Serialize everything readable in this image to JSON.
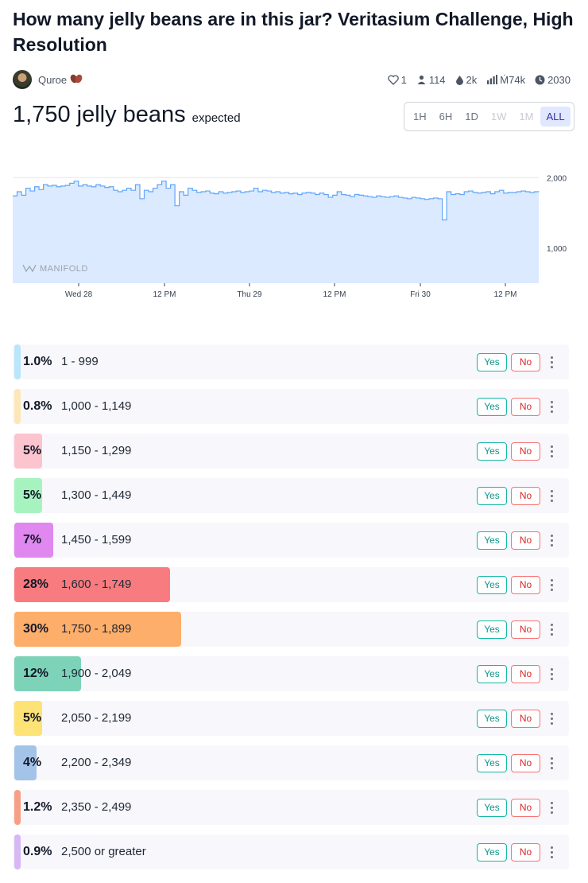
{
  "market": {
    "title": "How many jelly beans are in this jar? Veritasium Challenge, High Resolution",
    "author": "Quroe",
    "author_badge_icon": "beans-icon",
    "stats": {
      "likes": "1",
      "traders": "114",
      "liquidity": "2k",
      "volume": "Ṁ74k",
      "close": "2030"
    },
    "expected_value": "1,750 jelly beans",
    "expected_label": "expected"
  },
  "time_ranges": [
    {
      "label": "1H",
      "state": "normal"
    },
    {
      "label": "6H",
      "state": "normal"
    },
    {
      "label": "1D",
      "state": "normal"
    },
    {
      "label": "1W",
      "state": "disabled"
    },
    {
      "label": "1M",
      "state": "disabled"
    },
    {
      "label": "ALL",
      "state": "active"
    }
  ],
  "chart_data": {
    "type": "area",
    "watermark": "MANIFOLD",
    "x_ticks": [
      "Wed 28",
      "12 PM",
      "Thu 29",
      "12 PM",
      "Fri 30",
      "12 PM"
    ],
    "y_ticks": [
      "2,000",
      "1,000"
    ],
    "ylim": [
      500,
      2150
    ],
    "fill_color": "#dbeafe",
    "line_color": "#60a5fa",
    "series": [
      {
        "values": [
          1740,
          1800,
          1750,
          1850,
          1810,
          1870,
          1830,
          1900,
          1880,
          1890,
          1870,
          1880,
          1890,
          1920,
          1950,
          1880,
          1900,
          1880,
          1870,
          1900,
          1880,
          1860,
          1870,
          1820,
          1800,
          1820,
          1850,
          1820,
          1900,
          1700,
          1820,
          1800,
          1850,
          1900,
          1950,
          1850,
          1900,
          1600,
          1800,
          1750,
          1850,
          1820,
          1790,
          1800,
          1810,
          1780,
          1770,
          1800,
          1780,
          1790,
          1800,
          1810,
          1790,
          1800,
          1810,
          1850,
          1800,
          1820,
          1810,
          1790,
          1800,
          1780,
          1790,
          1770,
          1780,
          1760,
          1780,
          1790,
          1780,
          1760,
          1780,
          1760,
          1720,
          1750,
          1800,
          1760,
          1750,
          1730,
          1760,
          1750,
          1740,
          1730,
          1720,
          1740,
          1730,
          1720,
          1730,
          1740,
          1720,
          1710,
          1700,
          1720,
          1710,
          1700,
          1690,
          1700,
          1710,
          1700,
          1400,
          1800,
          1760,
          1770,
          1760,
          1800,
          1810,
          1790,
          1780,
          1790,
          1800,
          1770,
          1800,
          1820,
          1780,
          1790,
          1790,
          1800,
          1810,
          1800,
          1790,
          1800,
          1795
        ]
      }
    ]
  },
  "answers": [
    {
      "pct": "1.0%",
      "range": "1 - 999",
      "fraction": 0.01,
      "color": "#bae6fd"
    },
    {
      "pct": "0.8%",
      "range": "1,000 - 1,149",
      "fraction": 0.008,
      "color": "#fde7b8"
    },
    {
      "pct": "5%",
      "range": "1,150 - 1,299",
      "fraction": 0.05,
      "color": "#fbc4cf"
    },
    {
      "pct": "5%",
      "range": "1,300 - 1,449",
      "fraction": 0.05,
      "color": "#a7f3c0"
    },
    {
      "pct": "7%",
      "range": "1,450 - 1,599",
      "fraction": 0.07,
      "color": "#e087f0"
    },
    {
      "pct": "28%",
      "range": "1,600 - 1,749",
      "fraction": 0.28,
      "color": "#f87c7f"
    },
    {
      "pct": "30%",
      "range": "1,750 - 1,899",
      "fraction": 0.3,
      "color": "#fdae6b"
    },
    {
      "pct": "12%",
      "range": "1,900 - 2,049",
      "fraction": 0.12,
      "color": "#7dd3b8"
    },
    {
      "pct": "5%",
      "range": "2,050 - 2,199",
      "fraction": 0.05,
      "color": "#fde276"
    },
    {
      "pct": "4%",
      "range": "2,200 - 2,349",
      "fraction": 0.04,
      "color": "#a3c4e8"
    },
    {
      "pct": "1.2%",
      "range": "2,350 - 2,499",
      "fraction": 0.012,
      "color": "#f79f85"
    },
    {
      "pct": "0.9%",
      "range": "2,500 or greater",
      "fraction": 0.009,
      "color": "#d6b8f5"
    }
  ],
  "buttons": {
    "yes": "Yes",
    "no": "No"
  }
}
